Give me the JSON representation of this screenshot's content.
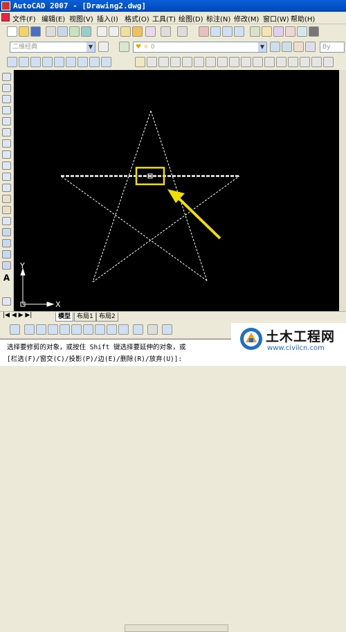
{
  "window": {
    "title": "AutoCAD 2007 - [Drawing2.dwg]"
  },
  "menu": {
    "items": [
      "文件(F)",
      "编辑(E)",
      "视图(V)",
      "插入(I)",
      "格式(O)",
      "工具(T)",
      "绘图(D)",
      "标注(N)",
      "修改(M)",
      "窗口(W)",
      "帮助(H)"
    ]
  },
  "toolbar": {
    "workspace_combo": "二维经典",
    "layer_combo": "0",
    "color_combo": "By"
  },
  "canvas": {
    "background": "#000000",
    "ucs_x_label": "X",
    "ucs_y_label": "Y",
    "highlight_color": "#f0e000",
    "arrow_color": "#f0e000"
  },
  "layout_tabs": {
    "items": [
      "模型",
      "布局1",
      "布局2"
    ]
  },
  "command": {
    "line1": "选择要修剪的对象，或按住 Shift 键选择要延伸的对象，或",
    "line2": "[栏选(F)/窗交(C)/投影(P)/边(E)/删除(R)/放弃(U)]:"
  },
  "watermark": {
    "brand": "土木工程网",
    "url": "www.civilcn.com"
  },
  "icons": [
    "autocad-app-icon",
    "new-icon",
    "open-icon",
    "save-icon",
    "print-icon",
    "cut-icon",
    "copy-icon",
    "paste-icon",
    "undo-icon",
    "redo-icon",
    "pan-icon",
    "zoom-icon",
    "calculator-icon",
    "line-icon",
    "polyline-icon",
    "circle-icon",
    "arc-icon",
    "rectangle-icon",
    "hatch-icon",
    "text-icon",
    "erase-icon",
    "move-icon",
    "rotate-icon",
    "trim-icon",
    "extend-icon"
  ]
}
